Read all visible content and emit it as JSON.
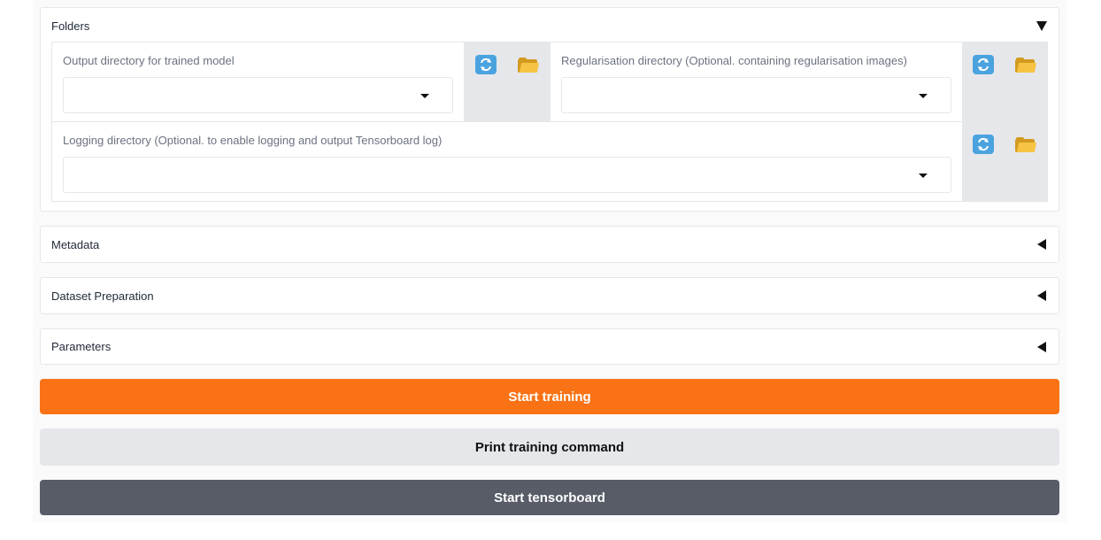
{
  "folders": {
    "title": "Folders",
    "output_dir_label": "Output directory for trained model",
    "output_dir_value": "",
    "reg_dir_label": "Regularisation directory (Optional. containing regularisation images)",
    "reg_dir_value": "",
    "logging_dir_label": "Logging directory (Optional. to enable logging and output Tensorboard log)",
    "logging_dir_value": "",
    "refresh_icon": "refresh-icon",
    "folder_icon": "folder-open-icon"
  },
  "sections": {
    "metadata": "Metadata",
    "dataset_preparation": "Dataset Preparation",
    "parameters": "Parameters"
  },
  "buttons": {
    "start_training": "Start training",
    "print_command": "Print training command",
    "start_tensorboard": "Start tensorboard"
  },
  "colors": {
    "primary": "#f97316",
    "secondary": "#e5e7eb",
    "dark": "#575c66"
  }
}
